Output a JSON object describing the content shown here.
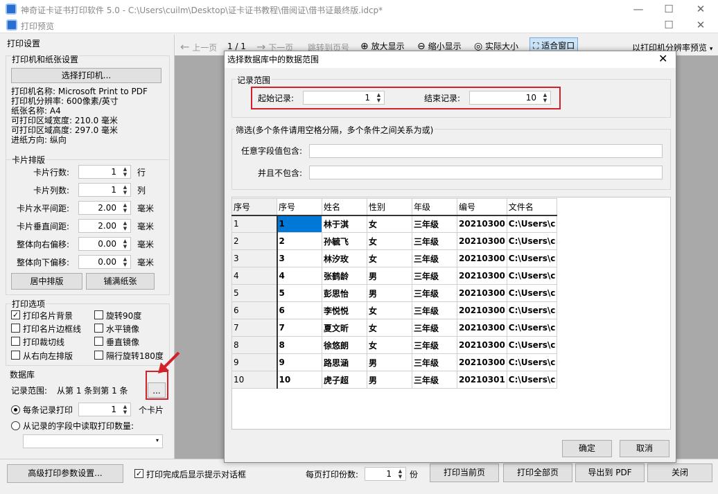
{
  "app_title": "神奇证卡证书打印软件 5.0 - C:\\Users\\cuilm\\Desktop\\证卡证书教程\\借阅证\\借书证最终版.idcp*",
  "preview_title": "打印预览",
  "left": {
    "heading": "打印设置",
    "printer_group": "打印机和纸张设置",
    "select_printer": "选择打印机...",
    "info": [
      "打印机名称: Microsoft Print to PDF",
      "打印机分辨率: 600像素/英寸",
      "纸张名称: A4",
      "可打印区域宽度: 210.0 毫米",
      "可打印区域高度: 297.0 毫米",
      "进纸方向: 纵向"
    ],
    "layout_group": "卡片排版",
    "layout_rows": [
      {
        "label": "卡片行数:",
        "value": "1",
        "unit": "行"
      },
      {
        "label": "卡片列数:",
        "value": "1",
        "unit": "列"
      },
      {
        "label": "卡片水平间距:",
        "value": "2.00",
        "unit": "毫米"
      },
      {
        "label": "卡片垂直间距:",
        "value": "2.00",
        "unit": "毫米"
      },
      {
        "label": "整体向右偏移:",
        "value": "0.00",
        "unit": "毫米"
      },
      {
        "label": "整体向下偏移:",
        "value": "0.00",
        "unit": "毫米"
      }
    ],
    "center_btn": "居中排版",
    "fill_btn": "铺满纸张",
    "options_group": "打印选项",
    "options": [
      {
        "label": "打印名片背景",
        "checked": true
      },
      {
        "label": "旋转90度",
        "checked": false
      },
      {
        "label": "打印名片边框线",
        "checked": false
      },
      {
        "label": "水平镜像",
        "checked": false
      },
      {
        "label": "打印裁切线",
        "checked": false
      },
      {
        "label": "垂直镜像",
        "checked": false
      },
      {
        "label": "从右向左排版",
        "checked": false
      },
      {
        "label": "隔行旋转180度",
        "checked": false
      }
    ],
    "db_group": "数据库",
    "range_label": "记录范围:",
    "range_value": "从第 1 条到第 1 条",
    "browse_btn": "...",
    "each_label": "每条记录打印",
    "each_value": "1",
    "each_unit": "个卡片",
    "field_label": "从记录的字段中读取打印数量:"
  },
  "toolbar": {
    "prev": "上一页",
    "page": "1 / 1",
    "next": "下一页",
    "jump": "跳转到页号",
    "zoom_in": "放大显示",
    "zoom_out": "缩小显示",
    "actual": "实际大小",
    "fit": "适合窗口",
    "res_preview": "以打印机分辨率预览"
  },
  "bottom": {
    "advanced": "高级打印参数设置...",
    "show_dialog": "打印完成后显示提示对话框",
    "copies_label": "每页打印份数:",
    "copies_value": "1",
    "copies_unit": "份",
    "print_current": "打印当前页",
    "print_all": "打印全部页",
    "export_pdf": "导出到 PDF",
    "close": "关闭"
  },
  "dialog": {
    "title": "选择数据库中的数据范围",
    "range_group": "记录范围",
    "start_label": "起始记录:",
    "start_value": "1",
    "end_label": "结束记录:",
    "end_value": "10",
    "filter_group": "筛选(多个条件请用空格分隔，多个条件之间关系为或)",
    "contains_label": "任意字段值包含:",
    "not_contains_label": "并且不包含:",
    "columns": [
      "序号",
      "序号",
      "姓名",
      "性别",
      "年级",
      "编号",
      "文件名"
    ],
    "rows": [
      [
        "1",
        "1",
        "林于淇",
        "女",
        "三年级",
        "20210300",
        "C:\\Users\\c"
      ],
      [
        "2",
        "2",
        "孙毓飞",
        "女",
        "三年级",
        "20210300",
        "C:\\Users\\c"
      ],
      [
        "3",
        "3",
        "林汐玫",
        "女",
        "三年级",
        "20210300",
        "C:\\Users\\c"
      ],
      [
        "4",
        "4",
        "张鹤龄",
        "男",
        "三年级",
        "20210300",
        "C:\\Users\\c"
      ],
      [
        "5",
        "5",
        "彭思怡",
        "男",
        "三年级",
        "20210300",
        "C:\\Users\\c"
      ],
      [
        "6",
        "6",
        "李悦悦",
        "女",
        "三年级",
        "20210300",
        "C:\\Users\\c"
      ],
      [
        "7",
        "7",
        "夏文昕",
        "女",
        "三年级",
        "20210300",
        "C:\\Users\\c"
      ],
      [
        "8",
        "8",
        "徐悠朗",
        "女",
        "三年级",
        "20210300",
        "C:\\Users\\c"
      ],
      [
        "9",
        "9",
        "路思涵",
        "男",
        "三年级",
        "20210300",
        "C:\\Users\\c"
      ],
      [
        "10",
        "10",
        "虎子超",
        "男",
        "三年级",
        "20210301",
        "C:\\Users\\c"
      ]
    ],
    "ok": "确定",
    "cancel": "取消"
  },
  "colors": {
    "highlight_red": "#d4202a",
    "selection_blue": "#0078d7"
  }
}
